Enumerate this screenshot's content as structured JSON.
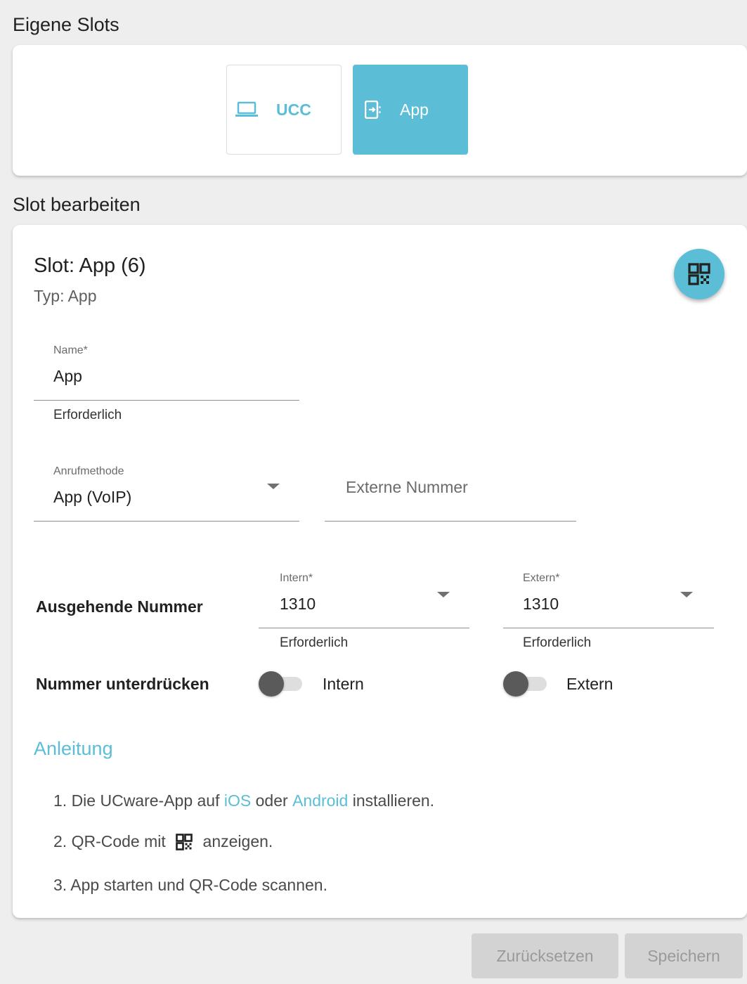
{
  "own_slots": {
    "title": "Eigene Slots",
    "slots": [
      {
        "label": "UCC",
        "icon": "laptop-icon",
        "selected": false
      },
      {
        "label": "App",
        "icon": "app-device-icon",
        "selected": true
      }
    ]
  },
  "edit_slot": {
    "section_title": "Slot bearbeiten",
    "title": "Slot: App (6)",
    "subtitle": "Typ: App",
    "qr_button_icon": "qr-code-icon",
    "name_field": {
      "label": "Name*",
      "value": "App",
      "hint": "Erforderlich"
    },
    "call_method": {
      "label": "Anrufmethode",
      "value": "App (VoIP)"
    },
    "external_number": {
      "placeholder": "Externe Nummer",
      "value": ""
    },
    "outgoing": {
      "label": "Ausgehende Nummer",
      "intern": {
        "label": "Intern*",
        "value": "1310",
        "hint": "Erforderlich"
      },
      "extern": {
        "label": "Extern*",
        "value": "1310",
        "hint": "Erforderlich"
      }
    },
    "suppress": {
      "label": "Nummer unterdrücken",
      "intern_label": "Intern",
      "extern_label": "Extern",
      "intern_on": false,
      "extern_on": false
    },
    "guide": {
      "title": "Anleitung",
      "step1": {
        "prefix": "1. Die UCware-App auf ",
        "ios": "iOS",
        "middle": " oder ",
        "android": "Android",
        "suffix": " installieren."
      },
      "step2": {
        "prefix": "2. QR-Code mit ",
        "suffix": " anzeigen."
      },
      "step3": "3. App starten und QR-Code scannen."
    }
  },
  "footer": {
    "reset_label": "Zurücksetzen",
    "save_label": "Speichern"
  },
  "colors": {
    "accent": "#5bbdd6",
    "background": "#eeeeee",
    "disabled_button": "#d3d3d3"
  }
}
